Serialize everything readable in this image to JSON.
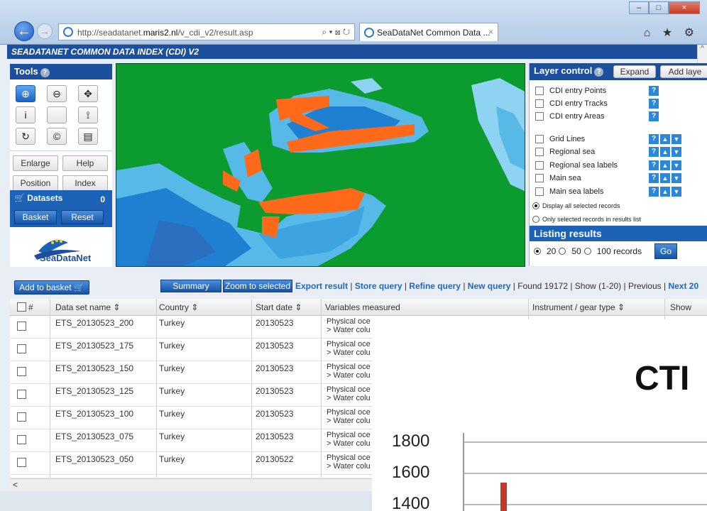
{
  "browser": {
    "url_prefix": "http://seadatanet.",
    "url_domain": "maris2.nl",
    "url_path": "/v_cdi_v2/result.asp",
    "address_tools": "⌕ ▾ ⊠ ↻",
    "tab_title": "SeaDataNet Common Data ...",
    "tab_close": "×",
    "window_buttons": [
      "–",
      "□",
      "×"
    ],
    "right_icons": "⌂ ★ ⚙",
    "back": "←",
    "forward": "→"
  },
  "app": {
    "header": "SEADATANET COMMON DATA INDEX (CDI) V2"
  },
  "tools": {
    "title": "Tools",
    "help": "?",
    "icons": [
      {
        "name": "zoom-in-icon",
        "glyph": "⊕"
      },
      {
        "name": "zoom-out-icon",
        "glyph": "⊖"
      },
      {
        "name": "pan-icon",
        "glyph": "✥"
      },
      {
        "name": "info-icon",
        "glyph": "i"
      },
      {
        "name": "blank-tool-icon",
        "glyph": ""
      },
      {
        "name": "select-icon",
        "glyph": "⟟"
      },
      {
        "name": "refresh-icon",
        "glyph": "↻"
      },
      {
        "name": "copyright-icon",
        "glyph": "©"
      },
      {
        "name": "list-icon",
        "glyph": "▤"
      }
    ],
    "enlarge": "Enlarge",
    "help_btn": "Help",
    "position": "Position",
    "index": "Index",
    "datasets_label": "Datasets",
    "datasets_count": "0",
    "basket": "Basket",
    "reset": "Reset",
    "logo_text": "SeaDataNet"
  },
  "layers": {
    "title": "Layer control",
    "help": "?",
    "expand": "Expand",
    "add_layer": "Add laye",
    "items": [
      {
        "label": "CDI entry Points",
        "arrows": false
      },
      {
        "label": "CDI entry Tracks",
        "arrows": false
      },
      {
        "label": "CDI entry Areas",
        "arrows": false
      },
      {
        "label": "Grid Lines",
        "arrows": true
      },
      {
        "label": "Regional sea",
        "arrows": true
      },
      {
        "label": "Regional sea labels",
        "arrows": true
      },
      {
        "label": "Main sea",
        "arrows": true
      },
      {
        "label": "Main sea labels",
        "arrows": true
      }
    ],
    "display_all": "Display all selected records",
    "only_selected": "Only selected records in results list",
    "listing_title": "Listing results",
    "opt_20": "20",
    "opt_50": "50",
    "opt_100": "100 records",
    "go": "Go"
  },
  "toolbar": {
    "add_to_basket": "Add to basket",
    "summary": "Summary",
    "zoom_selected": "Zoom to selected",
    "export": "Export result",
    "store": "Store query",
    "refine": "Refine query",
    "new": "New query",
    "found": "Found 19172",
    "show": "Show  (1-20)",
    "previous": "Previous",
    "next": "Next 20"
  },
  "table": {
    "columns": [
      "#",
      "Data set name ⇕",
      "Country ⇕",
      "Start date ⇕",
      "Variables measured",
      "Instrument / gear type ⇕",
      "Show"
    ],
    "rows": [
      {
        "name": "ETS_20130523_200",
        "country": "Turkey",
        "date": "20130523",
        "var1": "Physical oce",
        "var2": "> Water colu"
      },
      {
        "name": "ETS_20130523_175",
        "country": "Turkey",
        "date": "20130523",
        "var1": "Physical oce",
        "var2": "> Water colu"
      },
      {
        "name": "ETS_20130523_150",
        "country": "Turkey",
        "date": "20130523",
        "var1": "Physical oce",
        "var2": "> Water colu"
      },
      {
        "name": "ETS_20130523_125",
        "country": "Turkey",
        "date": "20130523",
        "var1": "Physical oce",
        "var2": "> Water colu"
      },
      {
        "name": "ETS_20130523_100",
        "country": "Turkey",
        "date": "20130523",
        "var1": "Physical oce",
        "var2": "> Water colu"
      },
      {
        "name": "ETS_20130523_075",
        "country": "Turkey",
        "date": "20130523",
        "var1": "Physical oce",
        "var2": "> Water colu"
      },
      {
        "name": "ETS_20130523_050",
        "country": "Turkey",
        "date": "20130522",
        "var1": "Physical oce",
        "var2": "> Water colu"
      }
    ],
    "scroll_left": "<"
  },
  "overlay": {
    "title": "CTI",
    "ticks": [
      "1800",
      "1600",
      "1400"
    ]
  },
  "colors": {
    "header_blue": "#1c4f9d",
    "button_blue": "#1c63b7",
    "map_land": "#0b9b2e",
    "map_sea_light": "#57b9e8",
    "map_sea_dark": "#1f7fd0",
    "data_points": "#ff6a1a"
  }
}
